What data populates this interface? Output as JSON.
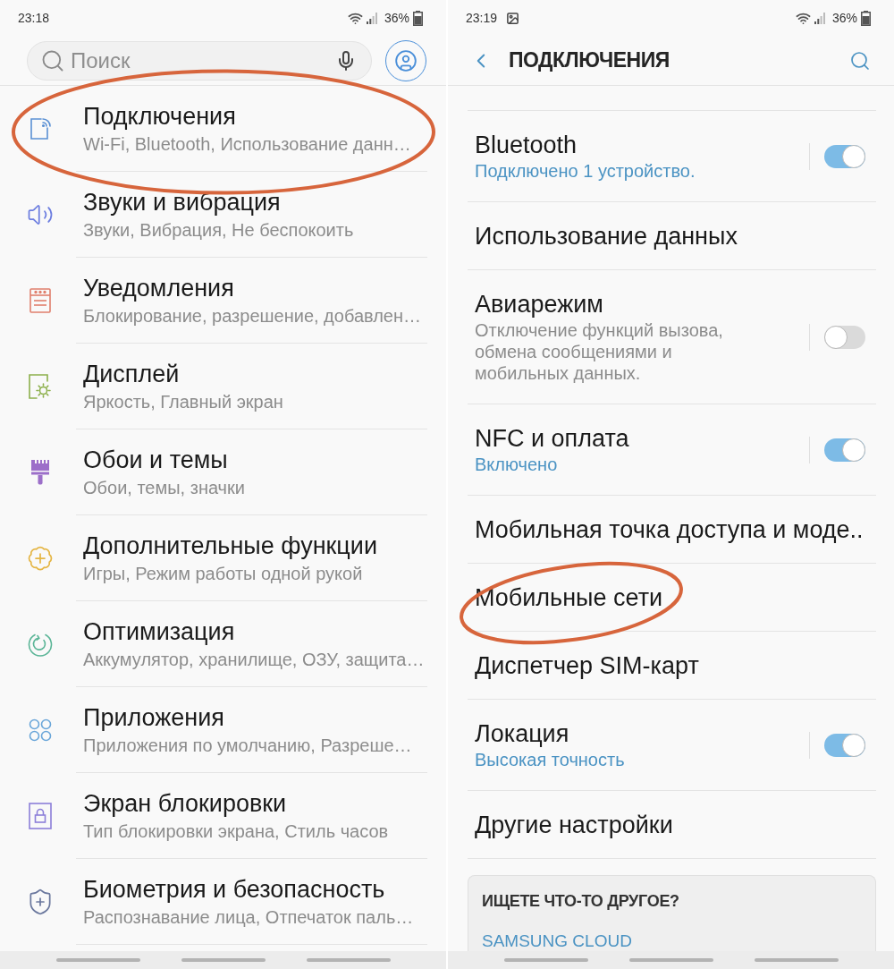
{
  "left_screen": {
    "status_bar": {
      "time": "23:18",
      "battery": "36%"
    },
    "search": {
      "placeholder": "Поиск"
    },
    "items": [
      {
        "title": "Подключения",
        "subtitle": "Wi-Fi, Bluetooth, Использование данн…",
        "circled": true
      },
      {
        "title": "Звуки и вибрация",
        "subtitle": "Звуки, Вибрация, Не беспокоить",
        "circled": false
      },
      {
        "title": "Уведомления",
        "subtitle": "Блокирование, разрешение, добавлен…",
        "circled": false
      },
      {
        "title": "Дисплей",
        "subtitle": "Яркость, Главный экран",
        "circled": false
      },
      {
        "title": "Обои и темы",
        "subtitle": "Обои, темы, значки",
        "circled": false
      },
      {
        "title": "Дополнительные функции",
        "subtitle": "Игры, Режим работы одной рукой",
        "circled": false
      },
      {
        "title": "Оптимизация",
        "subtitle": "Аккумулятор, хранилище, ОЗУ, защита…",
        "circled": false
      },
      {
        "title": "Приложения",
        "subtitle": "Приложения по умолчанию, Разреше…",
        "circled": false
      },
      {
        "title": "Экран блокировки",
        "subtitle": "Тип блокировки экрана, Стиль часов",
        "circled": false
      },
      {
        "title": "Биометрия и безопасность",
        "subtitle": "Распознавание лица, Отпечаток паль…",
        "circled": false
      }
    ]
  },
  "right_screen": {
    "status_bar": {
      "time": "23:19",
      "battery": "36%"
    },
    "header": {
      "title": "ПОДКЛЮЧЕНИЯ"
    },
    "items": [
      {
        "kind": "switch",
        "title": "Bluetooth",
        "status": "Подключено 1 устройство.",
        "on": true,
        "circled": false
      },
      {
        "kind": "plain",
        "title": "Использование данных",
        "circled": false
      },
      {
        "kind": "switch",
        "title": "Авиарежим",
        "description": "Отключение функций вызова, обмена сообщениями и мобильных данных.",
        "on": false,
        "circled": false
      },
      {
        "kind": "switch",
        "title": "NFC и оплата",
        "status": "Включено",
        "on": true,
        "circled": false
      },
      {
        "kind": "plain",
        "title": "Мобильная точка доступа и моде..",
        "circled": false
      },
      {
        "kind": "plain",
        "title": "Мобильные сети",
        "circled": true
      },
      {
        "kind": "plain",
        "title": "Диспетчер SIM-карт",
        "circled": false
      },
      {
        "kind": "switch",
        "title": "Локация",
        "status": "Высокая точность",
        "on": true,
        "circled": false
      },
      {
        "kind": "plain",
        "title": "Другие настройки",
        "circled": false
      }
    ],
    "card": {
      "title": "ИЩЕТЕ ЧТО-ТО ДРУГОЕ?",
      "links": [
        "SAMSUNG CLOUD"
      ]
    }
  }
}
